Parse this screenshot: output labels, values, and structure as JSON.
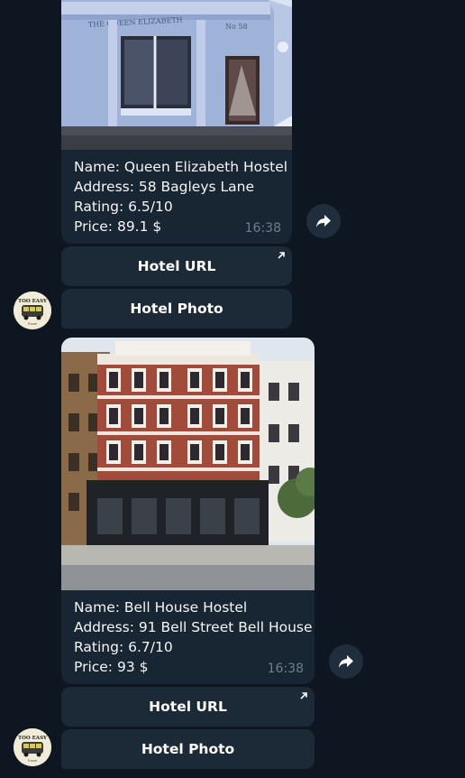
{
  "messages": [
    {
      "name_line": "Name: Queen Elizabeth Hostel",
      "address_line": "Address: 58 Bagleys Lane",
      "rating_line": "Rating: 6.5/10",
      "price_line": "Price: 89.1 $",
      "time": "16:38",
      "photo_sign_text": "THE QUEEN ELIZABETH",
      "photo_number_text": "No 58",
      "url_button": "Hotel URL",
      "photo_button": "Hotel Photo"
    },
    {
      "name_line": "Name: Bell House Hostel",
      "address_line": "Address: 91 Bell Street Bell House",
      "rating_line": "Rating: 6.7/10",
      "price_line": "Price: 93 $",
      "time": "16:38",
      "url_button": "Hotel URL",
      "photo_button": "Hotel Photo"
    }
  ],
  "avatar": {
    "logo_text": "TOO EASY",
    "logo_subtext": "Travel"
  },
  "icons": {
    "share": "share-arrow-icon",
    "external_link": "external-link-arrow-icon",
    "avatar": "bus-logo-avatar"
  },
  "colors": {
    "background": "#0e1621",
    "bubble": "#182533",
    "button": "#1c2a38",
    "time_text": "#6d7f8f"
  }
}
